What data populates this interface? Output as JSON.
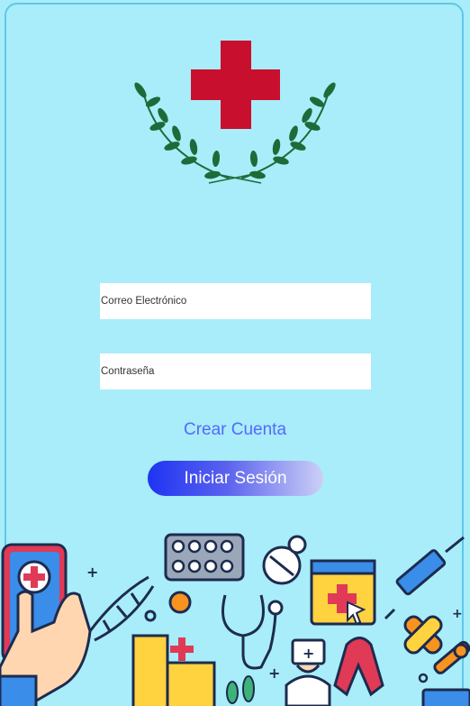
{
  "login": {
    "email_placeholder": "Correo Electrónico",
    "password_placeholder": "Contraseña",
    "create_account_label": "Crear Cuenta",
    "login_button_label": "Iniciar Sesión"
  },
  "colors": {
    "background": "#a8edf9",
    "cross": "#c8102e",
    "laurel": "#1e6b3a",
    "link": "#5468ff",
    "button_gradient_start": "#1f34f2",
    "button_gradient_end": "#cdd0f6"
  },
  "icons": [
    "red-cross-icon",
    "laurel-wreath-icon",
    "medical-illustration"
  ]
}
